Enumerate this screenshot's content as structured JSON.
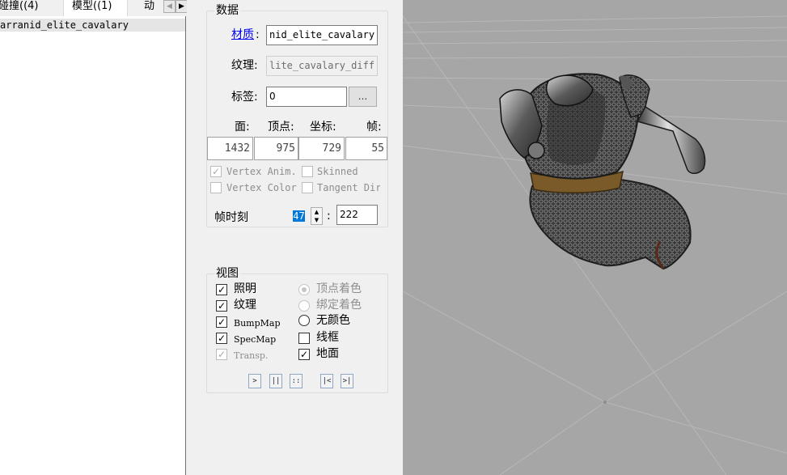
{
  "tabs": {
    "collision": "碰撞((4)",
    "model": "模型((1)",
    "anim": "动"
  },
  "list": {
    "items": [
      "arranid_elite_cavalary"
    ]
  },
  "data_group": {
    "title": "数据",
    "material_label": "材质",
    "colon": ":",
    "material_value": "nid_elite_cavalary",
    "texture_label": "纹理:",
    "texture_value": "lite_cavalary_diff",
    "tag_label": "标签:",
    "tag_value": "0",
    "tag_button": "...",
    "headers": {
      "faces": "面:",
      "verts": "顶点:",
      "coords": "坐标:",
      "frames": "帧:"
    },
    "stats": {
      "faces": "1432",
      "verts": "975",
      "coords": "729",
      "frames": "55"
    },
    "checkboxes": {
      "vertex_anim": "Vertex Anim.",
      "skinned": "Skinned",
      "vertex_color": "Vertex Color",
      "tangent_dir": "Tangent Dir"
    },
    "frame_time_label": "帧时刻",
    "frame_current": "47",
    "frame_colon": ":",
    "frame_total": "222"
  },
  "view_group": {
    "title": "视图",
    "lighting": "照明",
    "texture": "纹理",
    "bumpmap": "BumpMap",
    "specmap": "SpecMap",
    "transp": "Transp.",
    "vertex_color": "顶点着色",
    "bind_color": "绑定着色",
    "no_color": "无颜色",
    "wireframe": "线框",
    "ground": "地面",
    "check_mark": "✓"
  },
  "playback": {
    "play": ">",
    "pause": "||",
    "stop": "::",
    "first": "|<",
    "last": ">|"
  },
  "icons": {
    "scroll_left": "◀",
    "scroll_right": "▶",
    "spin_up": "▲",
    "spin_down": "▼"
  },
  "colors": {
    "viewport_bg": "#a6a6a6",
    "selection": "#0078d7",
    "link": "#0000ee"
  }
}
